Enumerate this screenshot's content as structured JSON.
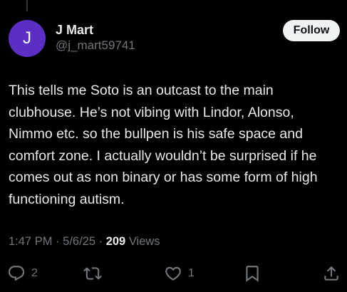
{
  "author": {
    "avatar_initial": "J",
    "name": "J Mart",
    "handle": "@j_mart59741",
    "avatar_color": "#5b2fc4"
  },
  "follow_label": "Follow",
  "tweet": {
    "text": "This tells me Soto is an outcast to the main clubhouse. He’s not vibing with Lindor, Alonso, Nimmo etc. so the bullpen is his safe space and comfort zone. I actually wouldn’t be surprised if he comes out as non binary or has some form of high functioning autism."
  },
  "meta": {
    "time": "1:47 PM",
    "separator1": "·",
    "date": "5/6/25",
    "separator2": "·",
    "views_count": "209",
    "views_label": "Views"
  },
  "actions": {
    "reply": {
      "icon": "reply-icon",
      "count": "2"
    },
    "repost": {
      "icon": "repost-icon",
      "count": ""
    },
    "like": {
      "icon": "heart-icon",
      "count": "1"
    },
    "bookmark": {
      "icon": "bookmark-icon"
    },
    "share": {
      "icon": "share-icon"
    }
  },
  "colors": {
    "background": "#000000",
    "text": "#e7e9ea",
    "secondary": "#71767b",
    "button_bg": "#eff3f4"
  }
}
